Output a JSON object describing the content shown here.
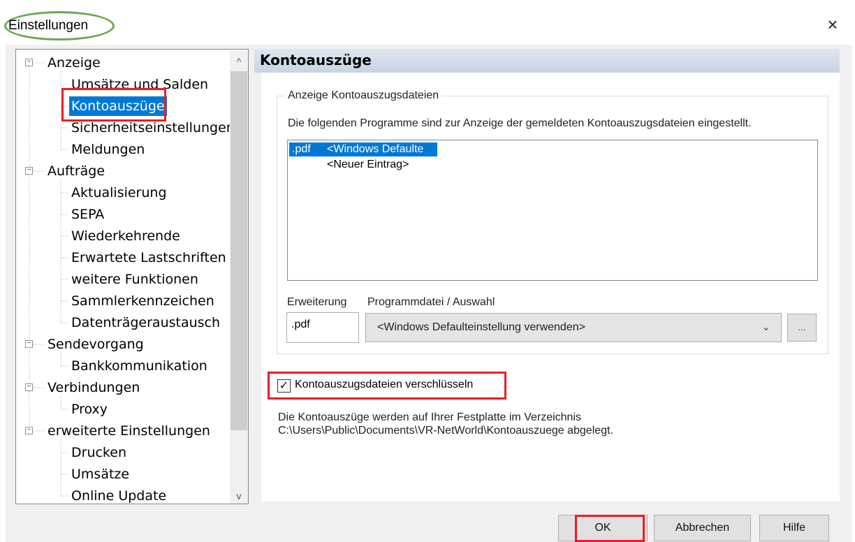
{
  "window": {
    "title": "Einstellungen",
    "close_glyph": "×"
  },
  "tree": {
    "groups": [
      {
        "label": "Anzeige",
        "children": [
          "Umsätze und Salden",
          "Kontoauszüge",
          "Sicherheitseinstellungen",
          "Meldungen"
        ]
      },
      {
        "label": "Aufträge",
        "children": [
          "Aktualisierung",
          "SEPA",
          "Wiederkehrende",
          "Erwartete Lastschriften",
          "weitere Funktionen",
          "Sammlerkennzeichen",
          "Datenträgeraustausch"
        ]
      },
      {
        "label": "Sendevorgang",
        "children": [
          "Bankkommunikation"
        ]
      },
      {
        "label": "Verbindungen",
        "children": [
          "Proxy"
        ]
      },
      {
        "label": "erweiterte Einstellungen",
        "children": [
          "Drucken",
          "Umsätze",
          "Online Update"
        ]
      }
    ],
    "selected": "Kontoauszüge",
    "expander_glyph": "−",
    "scroll_up_glyph": "^",
    "scroll_down_glyph": "v"
  },
  "panel": {
    "title": "Kontoauszüge",
    "group_label": "Anzeige Kontoauszugsdateien",
    "group_description": "Die folgenden Programme sind zur Anzeige der gemeldeten Kontoauszugsdateien eingestellt.",
    "list": [
      {
        "ext": ".pdf",
        "program": "<Windows Defaulte",
        "selected": true
      },
      {
        "ext": "",
        "program": "<Neuer Eintrag>",
        "selected": false
      }
    ],
    "extension_label": "Erweiterung",
    "program_label": "Programmdatei / Auswahl",
    "extension_value": ".pdf",
    "program_value": "<Windows Defaulteinstellung verwenden>",
    "browse_label": "...",
    "encrypt_checkbox": {
      "label": "Kontoauszugsdateien verschlüsseln",
      "checked": true,
      "glyph": "✓"
    },
    "info_line1": "Die Kontoauszüge werden auf Ihrer Festplatte im Verzeichnis",
    "info_line2": "C:\\Users\\Public\\Documents\\VR-NetWorld\\Kontoauszuege abgelegt."
  },
  "buttons": {
    "ok": "OK",
    "cancel": "Abbrechen",
    "help": "Hilfe"
  },
  "colors": {
    "highlight_red": "#ee1c25",
    "title_oval_green": "#6aa84f",
    "selection_blue": "#0078d7"
  }
}
